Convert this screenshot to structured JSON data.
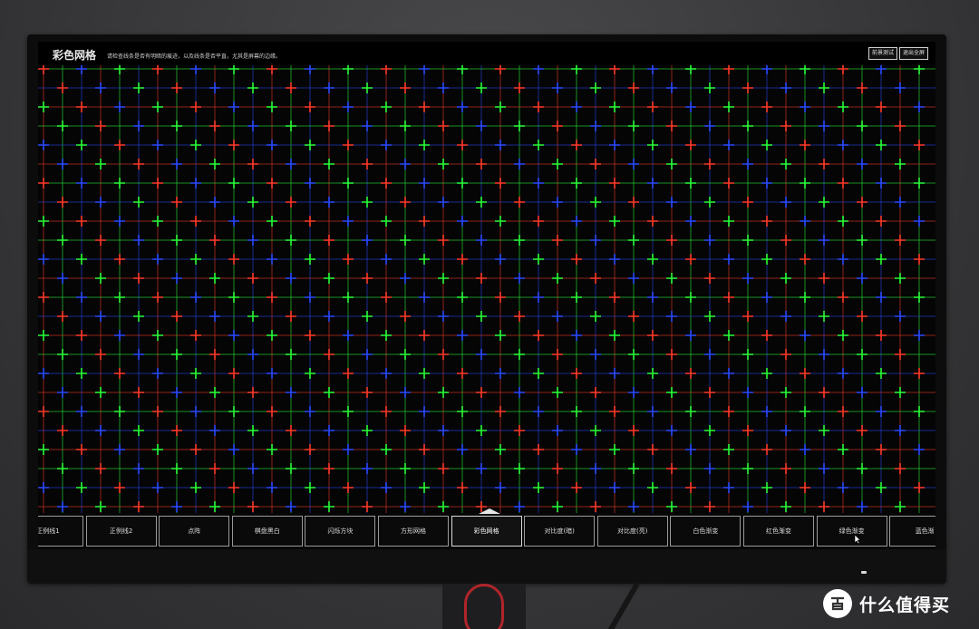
{
  "screen": {
    "title": "彩色网格",
    "subtitle": "请检查线条是否有明暗的痕迹，以及线条是否平直，尤其是屏幕的边缘。",
    "buttons": {
      "test": "前景测试",
      "exit": "退出全屏"
    }
  },
  "grid": {
    "colors": [
      "#ff3a2a",
      "#2aff3a",
      "#2a4aff"
    ],
    "background": "#050505"
  },
  "tabs": [
    {
      "label": "正例线1",
      "active": false
    },
    {
      "label": "正例线2",
      "active": false
    },
    {
      "label": "点阵",
      "active": false
    },
    {
      "label": "棋盘黑白",
      "active": false
    },
    {
      "label": "闪烁方块",
      "active": false
    },
    {
      "label": "方形网格",
      "active": false
    },
    {
      "label": "彩色网格",
      "active": true
    },
    {
      "label": "对比度(暗)",
      "active": false
    },
    {
      "label": "对比度(亮)",
      "active": false
    },
    {
      "label": "白色渐变",
      "active": false
    },
    {
      "label": "红色渐变",
      "active": false
    },
    {
      "label": "绿色渐变",
      "active": false
    },
    {
      "label": "蓝色渐",
      "active": false
    }
  ],
  "watermark": {
    "icon": "zhi-icon",
    "text": "什么值得买"
  }
}
